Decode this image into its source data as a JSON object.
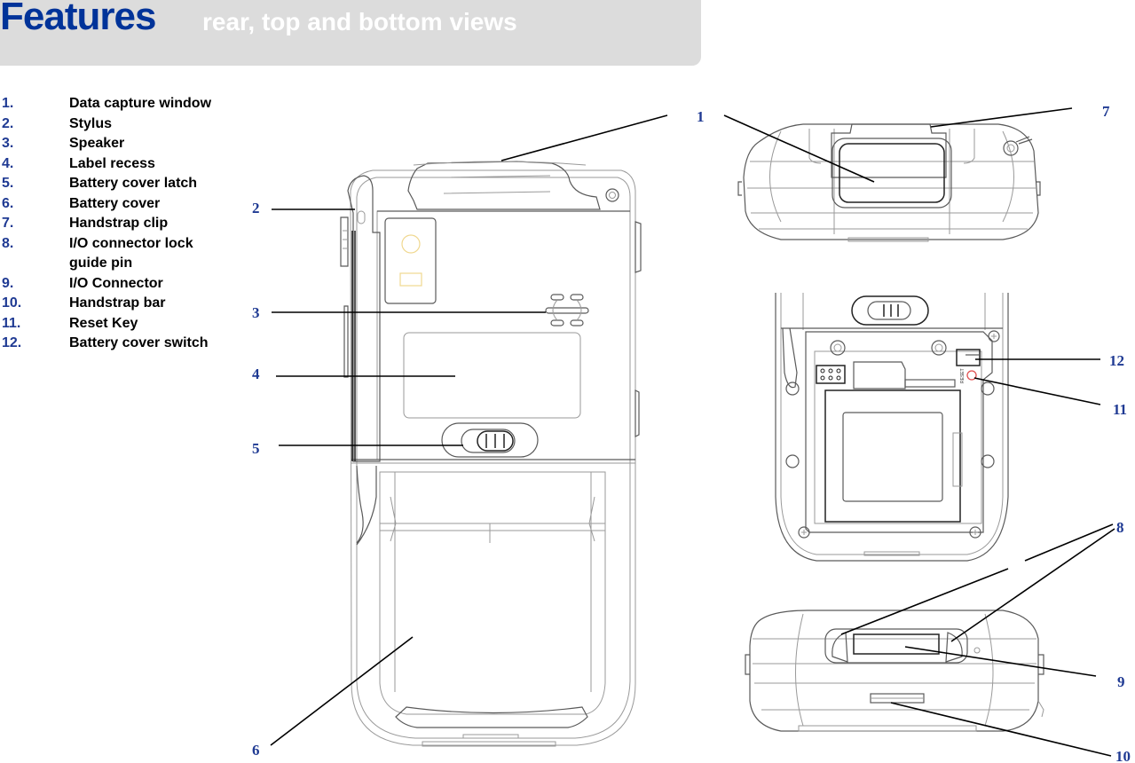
{
  "header": {
    "title": "Features",
    "subtitle": "rear, top and bottom views"
  },
  "legend": [
    {
      "num": "1.",
      "text": "Data capture window"
    },
    {
      "num": "2.",
      "text": "Stylus"
    },
    {
      "num": "3.",
      "text": "Speaker"
    },
    {
      "num": "4.",
      "text": "Label recess"
    },
    {
      "num": "5.",
      "text": "Battery cover latch"
    },
    {
      "num": "6.",
      "text": "Battery cover"
    },
    {
      "num": "7.",
      "text": "Handstrap clip"
    },
    {
      "num": "8.",
      "text": "I/O connector lock guide pin"
    },
    {
      "num": "9.",
      "text": "I/O Connector"
    },
    {
      "num": "10.",
      "text": "Handstrap bar"
    },
    {
      "num": "11.",
      "text": "Reset Key"
    },
    {
      "num": "12.",
      "text": "Battery cover switch"
    }
  ],
  "callouts": {
    "c1": "1",
    "c2": "2",
    "c3": "3",
    "c4": "4",
    "c5": "5",
    "c6": "6",
    "c7": "7",
    "c8": "8",
    "c9": "9",
    "c10": "10",
    "c11": "11",
    "c12": "12"
  },
  "views": {
    "rear": "rear view",
    "top": "top view",
    "bottom": "bottom view",
    "battery_compartment": "battery compartment view"
  },
  "battery_label": "RESET",
  "colors": {
    "title": "#003399",
    "callout": "#1f3a93",
    "header_bg": "#dcdcdc",
    "reset_key": "#e05050",
    "camera_marks": "#f0d890"
  }
}
